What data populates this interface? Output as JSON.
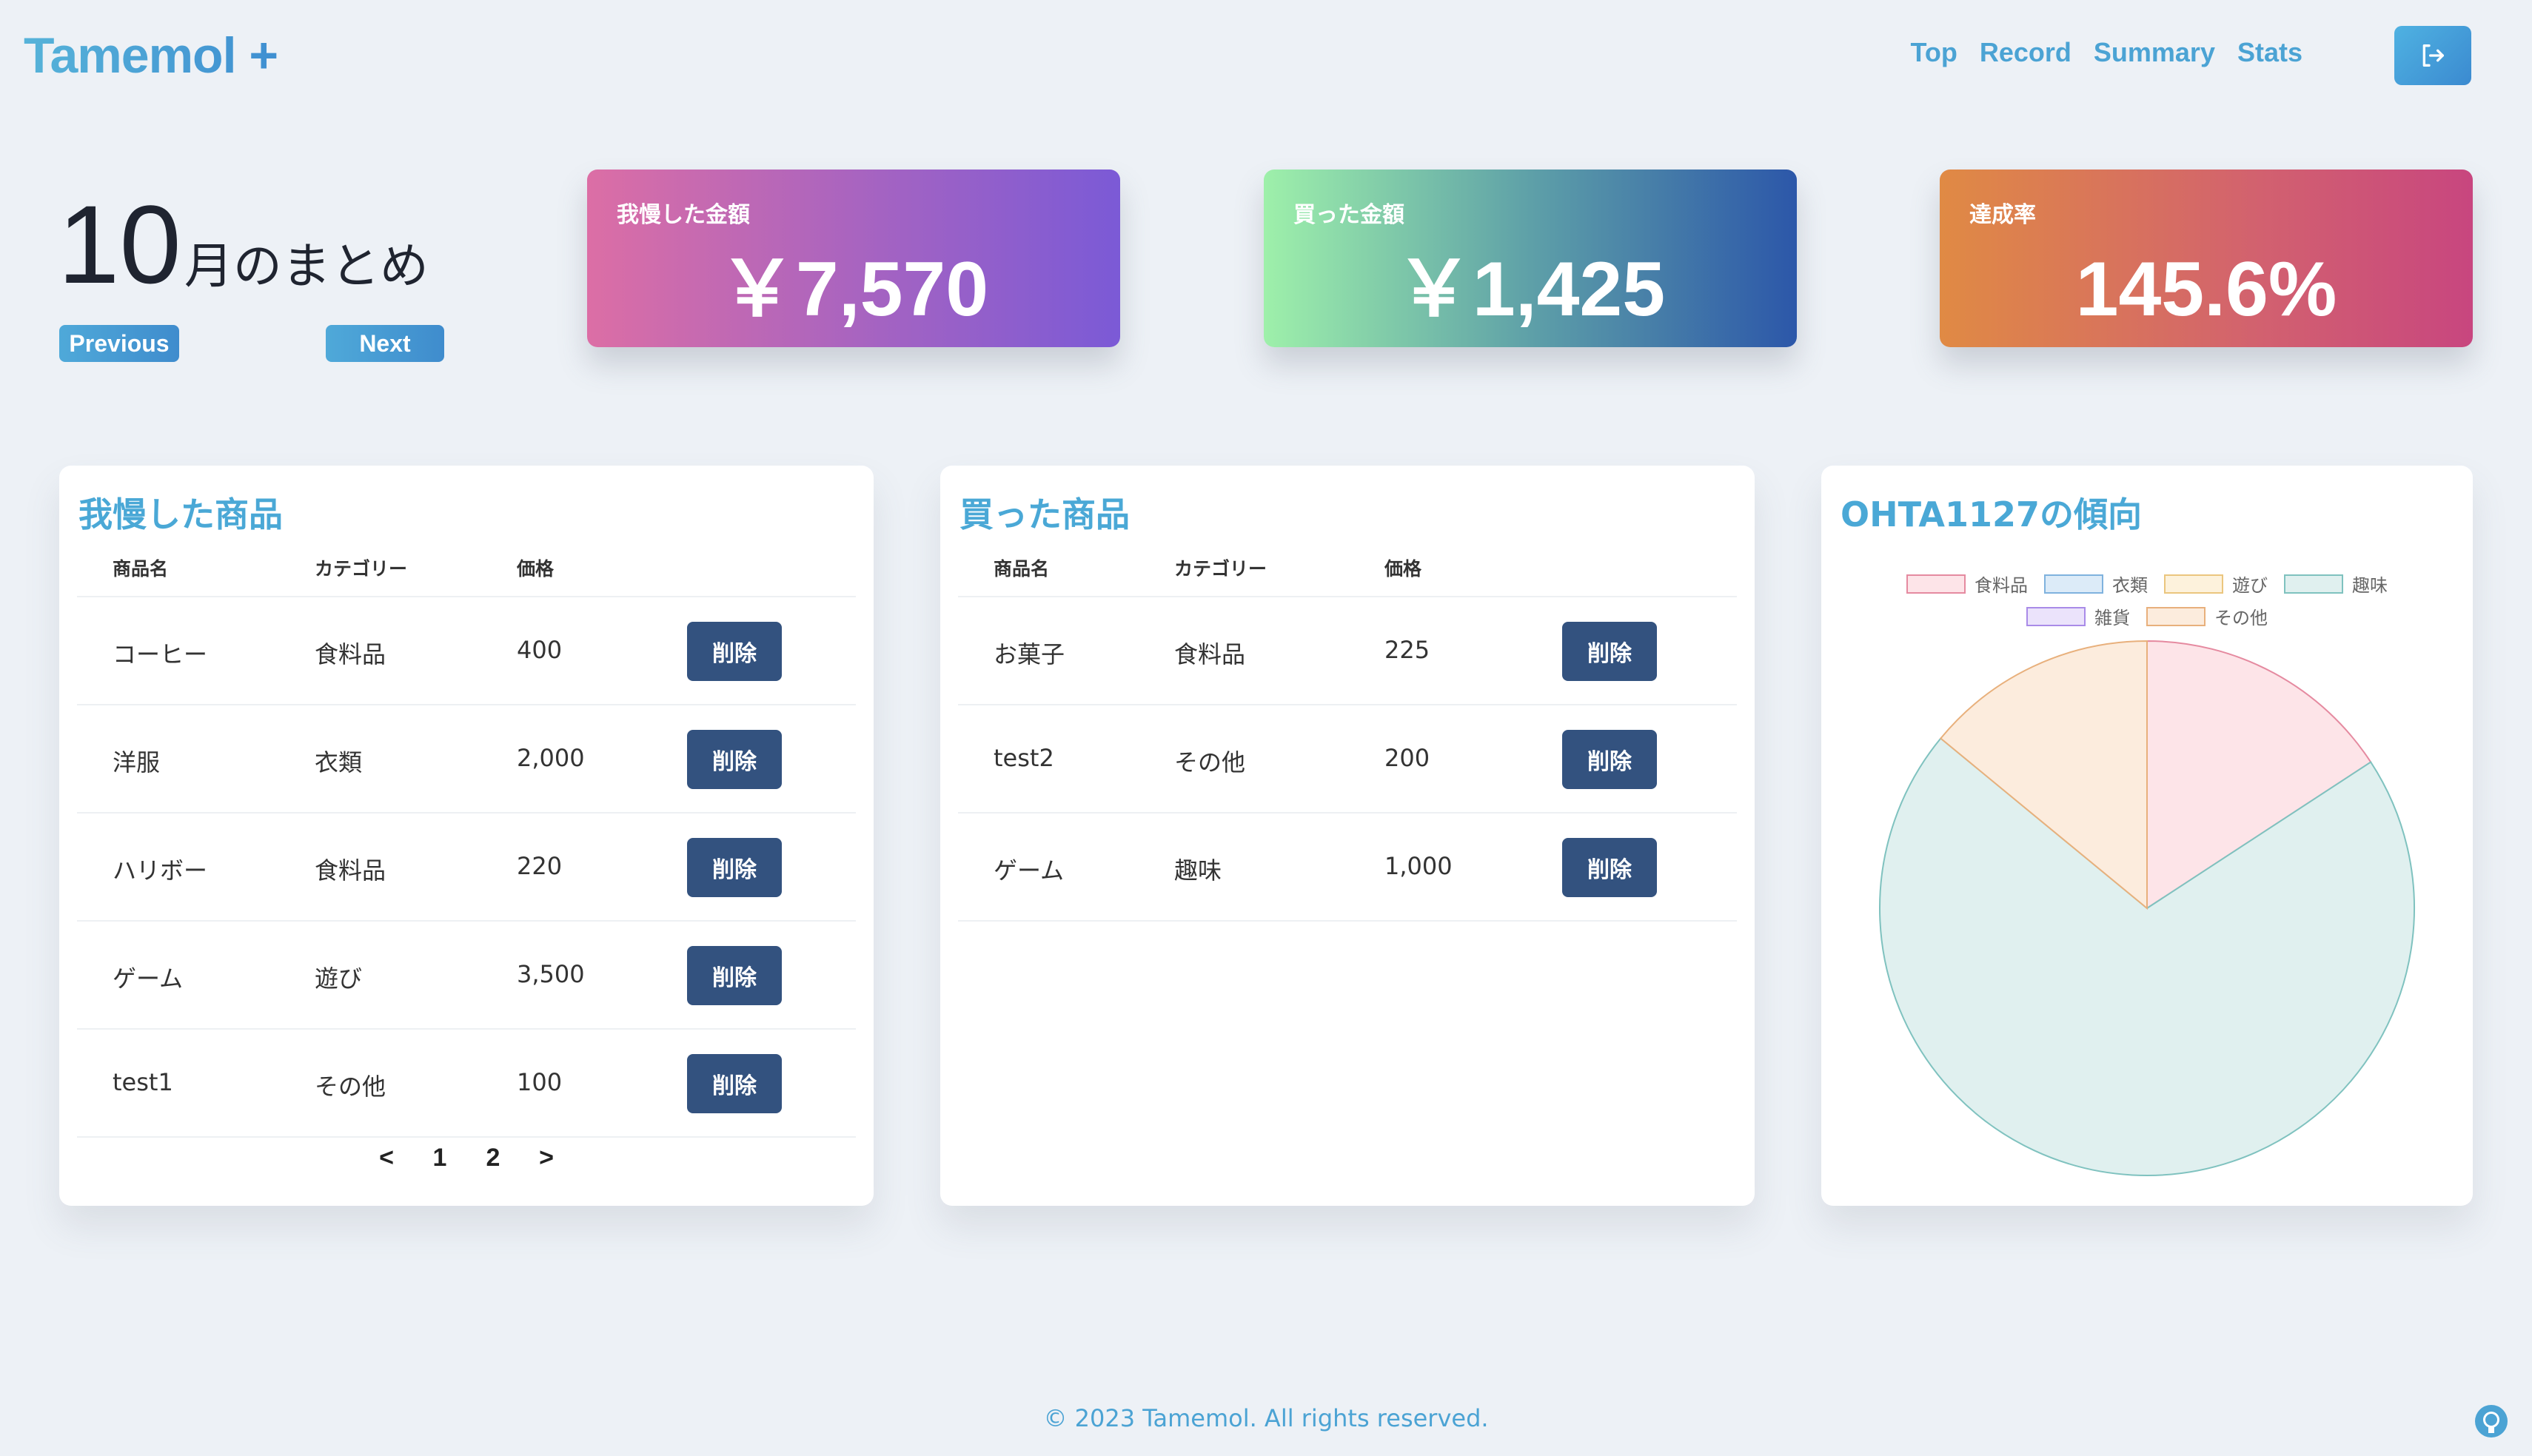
{
  "header": {
    "logo": "Tamemol +",
    "nav": [
      "Top",
      "Record",
      "Summary",
      "Stats"
    ],
    "logout_icon": "logout-icon"
  },
  "summary": {
    "month": "10",
    "title_suffix": "月のまとめ",
    "previous_label": "Previous",
    "next_label": "Next"
  },
  "stats": {
    "saved_label": "我慢した金額",
    "saved_value": "￥7,570",
    "bought_label": "買った金額",
    "bought_value": "￥1,425",
    "rate_label": "達成率",
    "rate_value": "145.6%"
  },
  "saved_items": {
    "title": "我慢した商品",
    "headers": [
      "商品名",
      "カテゴリー",
      "価格"
    ],
    "rows": [
      {
        "name": "コーヒー",
        "category": "食料品",
        "price": "400",
        "action": "削除"
      },
      {
        "name": "洋服",
        "category": "衣類",
        "price": "2,000",
        "action": "削除"
      },
      {
        "name": "ハリボー",
        "category": "食料品",
        "price": "220",
        "action": "削除"
      },
      {
        "name": "ゲーム",
        "category": "遊び",
        "price": "3,500",
        "action": "削除"
      },
      {
        "name": "test1",
        "category": "その他",
        "price": "100",
        "action": "削除"
      }
    ],
    "pagination": [
      "<",
      "1",
      "2",
      ">"
    ]
  },
  "bought_items": {
    "title": "買った商品",
    "headers": [
      "商品名",
      "カテゴリー",
      "価格"
    ],
    "rows": [
      {
        "name": "お菓子",
        "category": "食料品",
        "price": "225",
        "action": "削除"
      },
      {
        "name": "test2",
        "category": "その他",
        "price": "200",
        "action": "削除"
      },
      {
        "name": "ゲーム",
        "category": "趣味",
        "price": "1,000",
        "action": "削除"
      }
    ]
  },
  "trend": {
    "title": "OHTA1127の傾向"
  },
  "chart_data": {
    "type": "pie",
    "categories": [
      "食料品",
      "衣類",
      "遊び",
      "趣味",
      "雑貨",
      "その他"
    ],
    "values": [
      225,
      0,
      0,
      1000,
      0,
      200
    ],
    "colors": [
      {
        "fill": "#fde4e8",
        "stroke": "#e58aa0"
      },
      {
        "fill": "#dcebf8",
        "stroke": "#7fb2de"
      },
      {
        "fill": "#fdf2dc",
        "stroke": "#ebc67e"
      },
      {
        "fill": "#e0f0ef",
        "stroke": "#7fc2bf"
      },
      {
        "fill": "#ebe3fb",
        "stroke": "#a98be8"
      },
      {
        "fill": "#fcecdd",
        "stroke": "#e8b07c"
      }
    ],
    "legend_position": "top"
  },
  "footer": {
    "copyright": "© 2023 Tamemol. All rights reserved.",
    "github_icon": "github-icon"
  }
}
